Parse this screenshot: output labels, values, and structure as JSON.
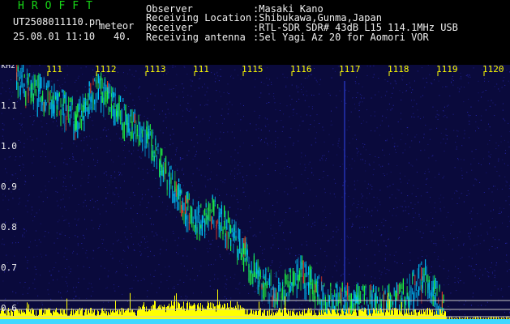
{
  "header": {
    "app_title": "HROFFT",
    "file_name": "UT2508011110.pn",
    "file_suffix": "meteor",
    "timestamp": "25.08.01 11:10",
    "counter": "40.",
    "meta": [
      {
        "key": "Observer",
        "value": ":Masaki Kano"
      },
      {
        "key": "Receiving Location",
        "value": ":Shibukawa,Gunma,Japan"
      },
      {
        "key": "Receiver",
        "value": ":RTL-SDR SDR# 43dB L15 114.1MHz USB"
      },
      {
        "key": "Receiving antenna",
        "value": ":5el Yagi Az 20 for Aomori VOR"
      }
    ]
  },
  "chart_data": {
    "type": "heatmap",
    "ylabel": "kHz",
    "y_ticks": [
      "1.1",
      "1.0",
      "0.9",
      "0.8",
      "0.7",
      "0.6"
    ],
    "x_ticks": [
      "111",
      "1112",
      "1113",
      "111",
      "1115",
      "1116",
      "1117",
      "1118",
      "1119",
      "1120"
    ],
    "colors": {
      "background": "#0a0a3c",
      "noise": "#2828b4",
      "signal_low": "#00c8ff",
      "signal_mid": "#20ff40",
      "signal_high": "#ff4020",
      "tick_label": "#ffff00",
      "axis_label": "#f0f0f0",
      "level_bar": "#ffff00",
      "baseline": "#40d8ff"
    }
  }
}
